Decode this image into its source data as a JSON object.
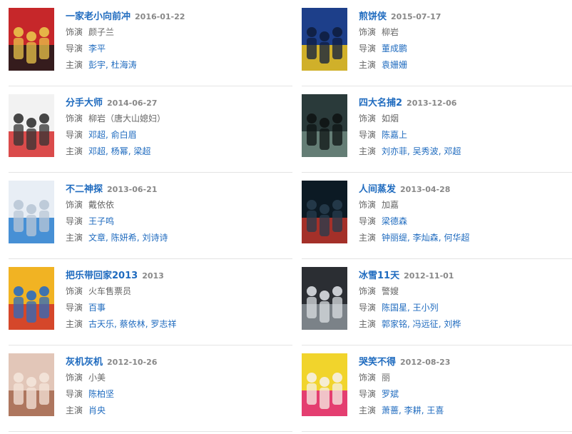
{
  "labels": {
    "role": "饰演",
    "director": "导演",
    "cast": "主演"
  },
  "movies": [
    {
      "title": "一家老小向前冲",
      "date": "2016-01-22",
      "role": "颜子兰",
      "directors": [
        "李平"
      ],
      "cast": [
        "彭宇",
        "杜海涛"
      ],
      "poster_colors": [
        "#c6272a",
        "#1b1b1b",
        "#e9c44a"
      ]
    },
    {
      "title": "煎饼侠",
      "date": "2015-07-17",
      "role": "柳岩",
      "directors": [
        "董成鹏"
      ],
      "cast": [
        "袁姗姗"
      ],
      "poster_colors": [
        "#1d3f8a",
        "#f0c419",
        "#0f1e3f"
      ]
    },
    {
      "title": "分手大师",
      "date": "2014-06-27",
      "role": "柳岩（唐大山媳妇）",
      "directors": [
        "邓超",
        "俞白眉"
      ],
      "cast": [
        "邓超",
        "杨幂",
        "梁超"
      ],
      "poster_colors": [
        "#f2f2f2",
        "#d62e2e",
        "#333333"
      ]
    },
    {
      "title": "四大名捕2",
      "date": "2013-12-06",
      "role": "如烟",
      "directors": [
        "陈嘉上"
      ],
      "cast": [
        "刘亦菲",
        "吴秀波",
        "邓超"
      ],
      "poster_colors": [
        "#2a3a3a",
        "#6f8a80",
        "#0e1414"
      ]
    },
    {
      "title": "不二神探",
      "date": "2013-06-21",
      "role": "戴依依",
      "directors": [
        "王子鸣"
      ],
      "cast": [
        "文章",
        "陈妍希",
        "刘诗诗"
      ],
      "poster_colors": [
        "#e8eef5",
        "#2a7fcf",
        "#b9c7d6"
      ]
    },
    {
      "title": "人间蒸发",
      "date": "2013-04-28",
      "role": "加嘉",
      "directors": [
        "梁德森"
      ],
      "cast": [
        "钟丽缇",
        "李灿森",
        "何华超"
      ],
      "poster_colors": [
        "#0c1a24",
        "#c0352a",
        "#263c4d"
      ]
    },
    {
      "title": "把乐带回家2013",
      "date": "2013",
      "role": "火车售票员",
      "directors": [
        "百事"
      ],
      "cast": [
        "古天乐",
        "蔡依林",
        "罗志祥"
      ],
      "poster_colors": [
        "#f1b323",
        "#d0342c",
        "#2b6bbf"
      ]
    },
    {
      "title": "冰雪11天",
      "date": "2012-11-01",
      "role": "警嫂",
      "directors": [
        "陈国星",
        "王小列"
      ],
      "cast": [
        "郭家铭",
        "冯远征",
        "刘桦"
      ],
      "poster_colors": [
        "#2b2e33",
        "#8a9098",
        "#d9dde1"
      ]
    },
    {
      "title": "灰机灰机",
      "date": "2012-10-26",
      "role": "小美",
      "directors": [
        "陈柏坚"
      ],
      "cast": [
        "肖央"
      ],
      "poster_colors": [
        "#e2c6b8",
        "#a4674d",
        "#f4e4da"
      ]
    },
    {
      "title": "哭笑不得",
      "date": "2012-08-23",
      "role": "丽",
      "directors": [
        "罗斌"
      ],
      "cast": [
        "萧蔷",
        "李耕",
        "王喜"
      ],
      "poster_colors": [
        "#f1d42c",
        "#e2237d",
        "#f6f0e6"
      ]
    }
  ]
}
